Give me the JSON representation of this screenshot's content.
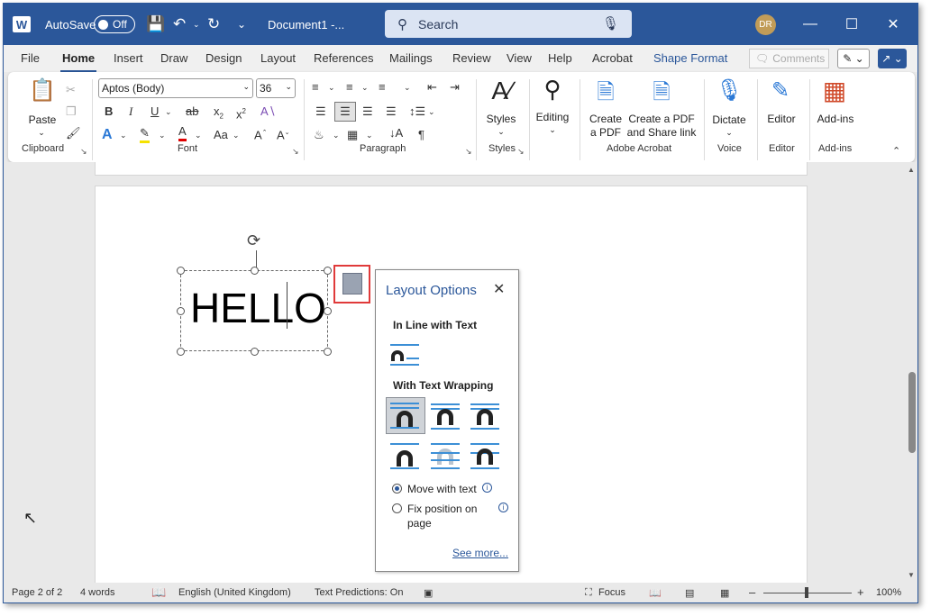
{
  "titlebar": {
    "app_logo": "W",
    "autosave_label": "AutoSave",
    "autosave_state": "Off",
    "doc_name": "Document1  -...",
    "search_placeholder": "Search",
    "user_initials": "DR"
  },
  "tabs": [
    "File",
    "Home",
    "Insert",
    "Draw",
    "Design",
    "Layout",
    "References",
    "Mailings",
    "Review",
    "View",
    "Help",
    "Acrobat",
    "Shape Format"
  ],
  "active_tab": "Home",
  "comments_label": "Comments",
  "ribbon": {
    "clipboard": {
      "paste": "Paste",
      "group": "Clipboard"
    },
    "font": {
      "name": "Aptos (Body)",
      "size": "36",
      "group": "Font"
    },
    "paragraph": {
      "group": "Paragraph"
    },
    "styles": {
      "label": "Styles",
      "group": "Styles"
    },
    "editing": {
      "label": "Editing"
    },
    "acrobat": {
      "create_pdf_1": "Create",
      "create_pdf_2": "a PDF",
      "share_1": "Create a PDF",
      "share_2": "and Share link",
      "group": "Adobe Acrobat"
    },
    "voice": {
      "label": "Dictate",
      "group": "Voice"
    },
    "editor": {
      "label": "Editor",
      "group": "Editor"
    },
    "addins": {
      "label": "Add-ins",
      "group": "Add-ins"
    }
  },
  "document": {
    "textbox_text": "HELLO"
  },
  "layout_options": {
    "title": "Layout Options",
    "inline_section": "In Line with Text",
    "wrap_section": "With Text Wrapping",
    "move_with_text": "Move with text",
    "fix_position_1": "Fix position on",
    "fix_position_2": "page",
    "selected_option": "Move with text",
    "see_more": "See more..."
  },
  "status": {
    "page": "Page 2 of 2",
    "words": "4 words",
    "language": "English (United Kingdom)",
    "predictions": "Text Predictions: On",
    "focus": "Focus",
    "zoom": "100%",
    "zoom_level": 1.0
  }
}
